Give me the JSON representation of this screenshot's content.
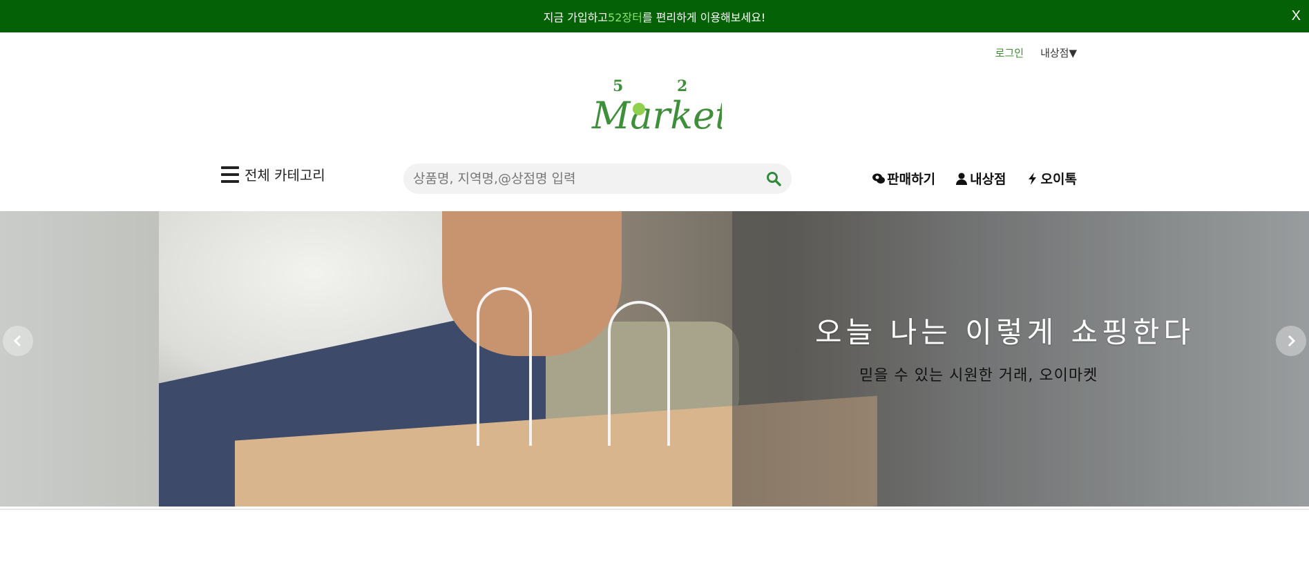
{
  "topbar": {
    "text_before": "지금 가입하고 ",
    "highlight": "52장터",
    "text_after": "를 편리하게 이용해보세요!",
    "close_label": "X",
    "bg_color": "#046106",
    "highlight_color": "#8fe06a"
  },
  "util": {
    "login_label": "로그인",
    "mystore_label": "내상점▼"
  },
  "logo": {
    "digit_left": "5",
    "digit_right": "2",
    "wordmark": "Market",
    "color": "#3f8f3a"
  },
  "nav": {
    "category_label": "전체 카테고리",
    "search_placeholder": "상품명, 지역명,@상점명 입력",
    "actions": [
      {
        "label": "판매하기",
        "icon": "chat-icon"
      },
      {
        "label": "내상점",
        "icon": "user-icon"
      },
      {
        "label": "오이톡",
        "icon": "bolt-icon"
      }
    ]
  },
  "banner": {
    "title": "오늘 나는 이렇게 쇼핑한다",
    "subtitle": "믿을 수 있는 시원한 거래, 오이마켓"
  }
}
